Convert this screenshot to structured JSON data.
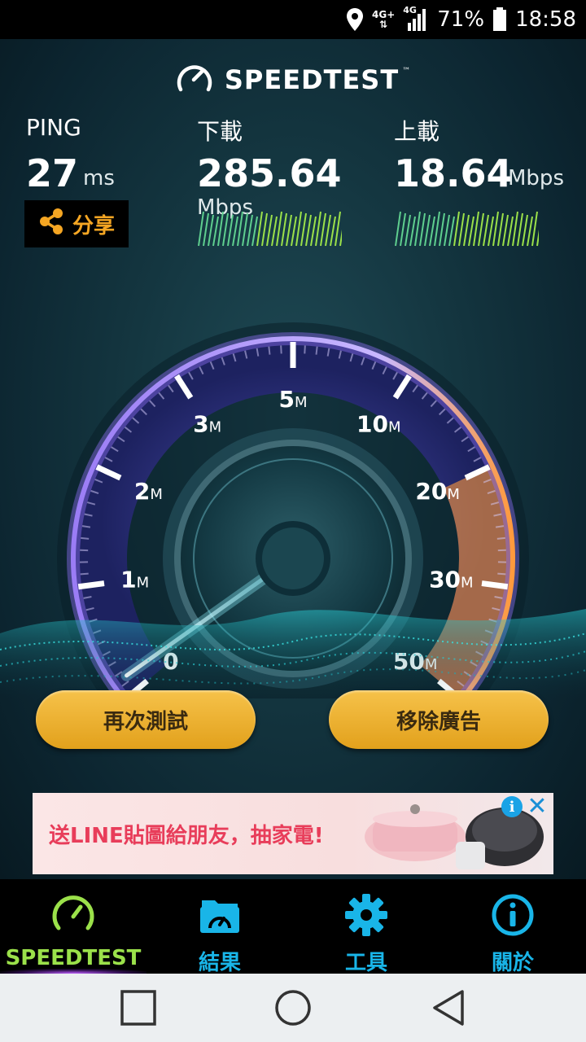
{
  "status_bar": {
    "network": "4G+",
    "network_secondary": "4G",
    "battery": "71%",
    "time": "18:58"
  },
  "app": {
    "logo_text": "SPEEDTEST",
    "logo_tm": "™"
  },
  "ping": {
    "label": "PING",
    "value": "27",
    "unit": "ms"
  },
  "download": {
    "label": "下載",
    "value": "285.64",
    "unit": "Mbps"
  },
  "upload": {
    "label": "上載",
    "value": "18.64",
    "unit": "Mbps"
  },
  "share_button": {
    "label": "分享"
  },
  "gauge": {
    "ticks": [
      {
        "num": "0",
        "unit": ""
      },
      {
        "num": "1",
        "unit": "M"
      },
      {
        "num": "2",
        "unit": "M"
      },
      {
        "num": "3",
        "unit": "M"
      },
      {
        "num": "5",
        "unit": "M"
      },
      {
        "num": "10",
        "unit": "M"
      },
      {
        "num": "20",
        "unit": "M"
      },
      {
        "num": "30",
        "unit": "M"
      },
      {
        "num": "50",
        "unit": "M"
      }
    ],
    "colors": {
      "arc_low": "#8a6cf0",
      "arc_high": "#ff9a3c",
      "needle": "#8ff3ff"
    }
  },
  "actions": {
    "retest_label": "再次測試",
    "remove_ads_label": "移除廣告"
  },
  "ad": {
    "text": "送LINE貼圖給朋友，抽家電!",
    "info_icon": "i",
    "close_icon": "✕"
  },
  "tabs": [
    {
      "label": "SPEEDTEST",
      "icon": "speedometer-icon"
    },
    {
      "label": "結果",
      "icon": "results-folder-icon"
    },
    {
      "label": "工具",
      "icon": "gear-icon"
    },
    {
      "label": "關於",
      "icon": "info-icon"
    }
  ],
  "navigation": {
    "recents_icon": "square-icon",
    "home_icon": "circle-icon",
    "back_icon": "triangle-back-icon"
  }
}
